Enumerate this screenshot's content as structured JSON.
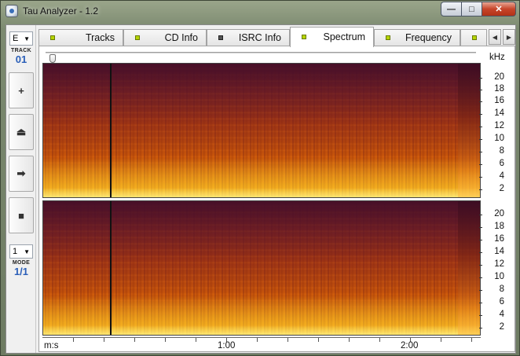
{
  "window": {
    "title": "Tau Analyzer - 1.2",
    "controls": {
      "minimize": "—",
      "maximize": "□",
      "close": "✕"
    }
  },
  "leftbar": {
    "drive_value": "E",
    "track_caption": "TRACK",
    "track_number": "01",
    "buttons": [
      {
        "name": "zoom-in-button",
        "icon": "plus-icon",
        "glyph": "+"
      },
      {
        "name": "eject-button",
        "icon": "eject-icon",
        "glyph": "⏏"
      },
      {
        "name": "play-button",
        "icon": "play-arrow-icon",
        "glyph": "➡"
      },
      {
        "name": "stop-button",
        "icon": "stop-icon",
        "glyph": "■"
      }
    ],
    "mode_value": "1",
    "mode_caption": "MODE",
    "mode_number": "1/1"
  },
  "tabs": [
    {
      "label": "Tracks",
      "led": "green"
    },
    {
      "label": "CD Info",
      "led": "green"
    },
    {
      "label": "ISRC Info",
      "led": "dark"
    },
    {
      "label": "Spectrum",
      "led": "green",
      "active": true
    },
    {
      "label": "Frequency",
      "led": "green"
    }
  ],
  "tab_scroll": {
    "left": "◀",
    "right": "▶"
  },
  "spectrum": {
    "unit_label": "kHz",
    "freq_ticks": [
      "20",
      "18",
      "16",
      "14",
      "12",
      "10",
      "8",
      "6",
      "4",
      "2"
    ],
    "time_axis_label": "m:s",
    "time_ticks": [
      "1:00",
      "2:00"
    ]
  },
  "colors": {
    "spectrum_low": "#f6c434",
    "spectrum_mid": "#c9560a",
    "spectrum_high": "#6a1d2c",
    "active_led": "#b6d500"
  }
}
